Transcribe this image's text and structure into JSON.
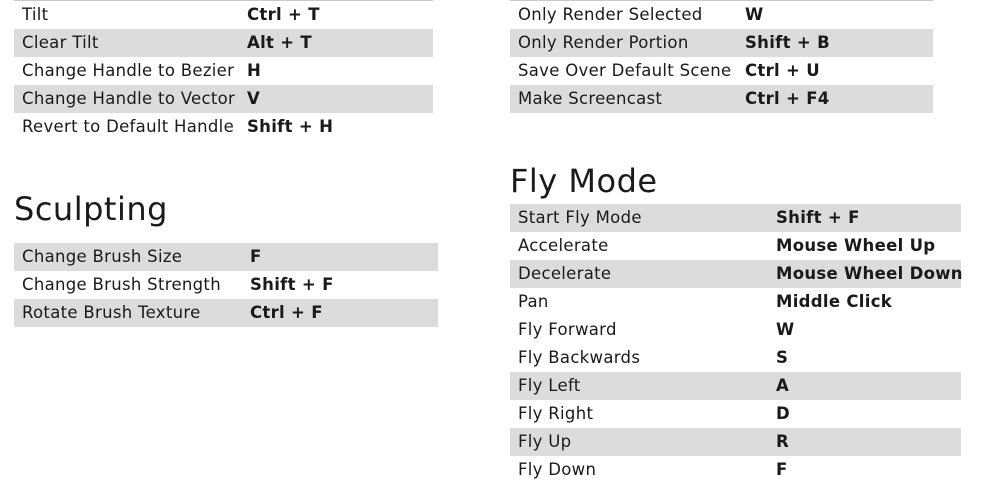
{
  "top_left": {
    "rows": [
      {
        "action": "Tilt",
        "key": "Ctrl + T"
      },
      {
        "action": "Clear Tilt",
        "key": "Alt + T"
      },
      {
        "action": "Change Handle to Bezier",
        "key": "H"
      },
      {
        "action": "Change Handle to Vector",
        "key": "V"
      },
      {
        "action": "Revert to Default Handle",
        "key": "Shift + H"
      }
    ]
  },
  "top_right": {
    "rows": [
      {
        "action": "Only Render Selected",
        "key": "W"
      },
      {
        "action": "Only Render Portion",
        "key": "Shift + B"
      },
      {
        "action": "Save Over Default Scene",
        "key": "Ctrl + U"
      },
      {
        "action": "Make Screencast",
        "key": "Ctrl + F4"
      }
    ]
  },
  "sculpting": {
    "title": "Sculpting",
    "rows": [
      {
        "action": "Change Brush Size",
        "key": "F"
      },
      {
        "action": "Change Brush Strength",
        "key": "Shift + F"
      },
      {
        "action": "Rotate Brush Texture",
        "key": "Ctrl + F"
      }
    ]
  },
  "fly_mode": {
    "title": "Fly Mode",
    "rows": [
      {
        "action": "Start Fly Mode",
        "key": "Shift + F"
      },
      {
        "action": "Accelerate",
        "key": "Mouse Wheel Up"
      },
      {
        "action": "Decelerate",
        "key": "Mouse Wheel Down"
      },
      {
        "action": "Pan",
        "key": "Middle Click"
      },
      {
        "action": "Fly Forward",
        "key": "W"
      },
      {
        "action": "Fly Backwards",
        "key": "S"
      },
      {
        "action": "Fly Left",
        "key": "A"
      },
      {
        "action": "Fly Right",
        "key": "D"
      },
      {
        "action": "Fly Up",
        "key": "R"
      },
      {
        "action": "Fly Down",
        "key": "F"
      }
    ]
  },
  "colors": {
    "row_shade": "#dcdcdc",
    "text": "#1a1a1a",
    "background": "#ffffff"
  }
}
